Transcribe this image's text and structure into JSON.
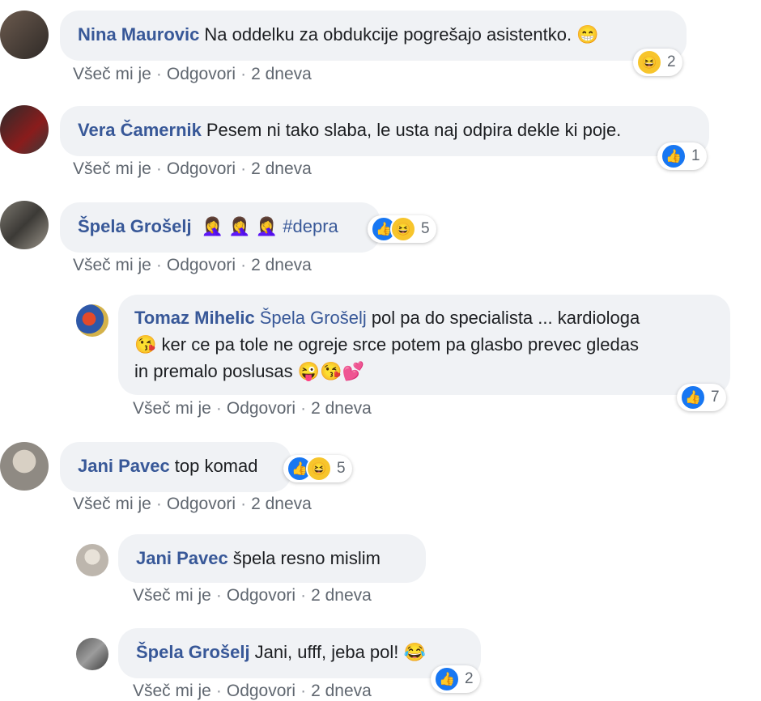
{
  "comments": [
    {
      "name": "Nina Maurovic",
      "text": "Na oddelku za obdukcije pogrešajo asistentko.",
      "emoji": "😁",
      "like_label": "Všeč mi je",
      "reply_label": "Odgovori",
      "time": "2 dneva",
      "reaction_count": "2"
    },
    {
      "name": "Vera Čamernik",
      "text": "Pesem ni tako slaba, le usta naj odpira dekle ki poje.",
      "like_label": "Všeč mi je",
      "reply_label": "Odgovori",
      "time": "2 dneva",
      "reaction_count": "1"
    },
    {
      "name": "Špela Grošelj",
      "emojis": "🤦‍♀️ 🤦‍♀️ 🤦‍♀️",
      "hashtag": "#depra",
      "like_label": "Všeč mi je",
      "reply_label": "Odgovori",
      "time": "2 dneva",
      "reaction_count": "5"
    },
    {
      "name": "Tomaz Mihelic",
      "mention": "Špela Grošelj",
      "text_line1": "pol pa do specialista ... kardiologa",
      "emoji1": "😘",
      "text_line2": "ker ce pa tole ne ogreje srce potem pa glasbo prevec gledas",
      "text_line3": "in premalo poslusas",
      "emoji_end": "😜😘💕",
      "like_label": "Všeč mi je",
      "reply_label": "Odgovori",
      "time": "2 dneva",
      "reaction_count": "7"
    },
    {
      "name": "Jani Pavec",
      "text": "top komad",
      "like_label": "Všeč mi je",
      "reply_label": "Odgovori",
      "time": "2 dneva",
      "reaction_count": "5"
    },
    {
      "name": "Jani Pavec",
      "text": "špela resno mislim",
      "like_label": "Všeč mi je",
      "reply_label": "Odgovori",
      "time": "2 dneva"
    },
    {
      "name": "Špela Grošelj",
      "text": "Jani, ufff, jeba pol!",
      "emoji": "😂",
      "like_label": "Všeč mi je",
      "reply_label": "Odgovori",
      "time": "2 dneva",
      "reaction_count": "2"
    }
  ],
  "icons": {
    "like": "thumbs-up-icon",
    "haha": "haha-icon"
  },
  "colors": {
    "name": "#385898",
    "bubble": "#f0f2f5",
    "like": "#1877f2",
    "meta": "#606770"
  }
}
